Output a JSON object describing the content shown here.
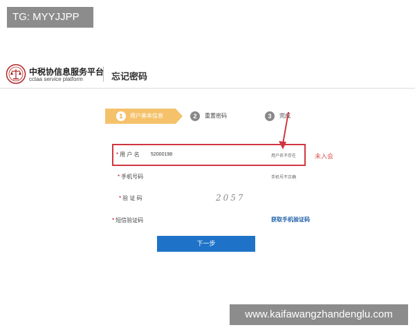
{
  "overlay": {
    "tg_label": "TG: MYYJJPP",
    "watermark": "www.kaifawangzhandenglu.com"
  },
  "header": {
    "brand_cn": "中税协信息服务平台",
    "brand_en": "cctaa  service platform",
    "page_title": "忘记密码"
  },
  "steps": [
    {
      "num": "1",
      "label": "用户基本信息",
      "state": "active"
    },
    {
      "num": "2",
      "label": "重置密码",
      "state": "inactive"
    },
    {
      "num": "3",
      "label": "完成",
      "state": "inactive"
    }
  ],
  "form": {
    "username": {
      "label": "用 户 名",
      "value": "52000198",
      "hint": "用户名不存在"
    },
    "phone": {
      "label": "手机号码",
      "hint": "手机号不正确"
    },
    "captcha": {
      "label": "验 证 码",
      "image_text": "2057"
    },
    "sms": {
      "label": "短信验证码",
      "link": "获取手机验证码"
    },
    "required_mark": "*",
    "next_button": "下一步"
  },
  "annotation": {
    "side_note": "未入会"
  },
  "colors": {
    "accent_orange": "#f5c26b",
    "primary_blue": "#1e73c8",
    "alert_red": "#d0353f",
    "link_blue": "#1e5fa8"
  }
}
